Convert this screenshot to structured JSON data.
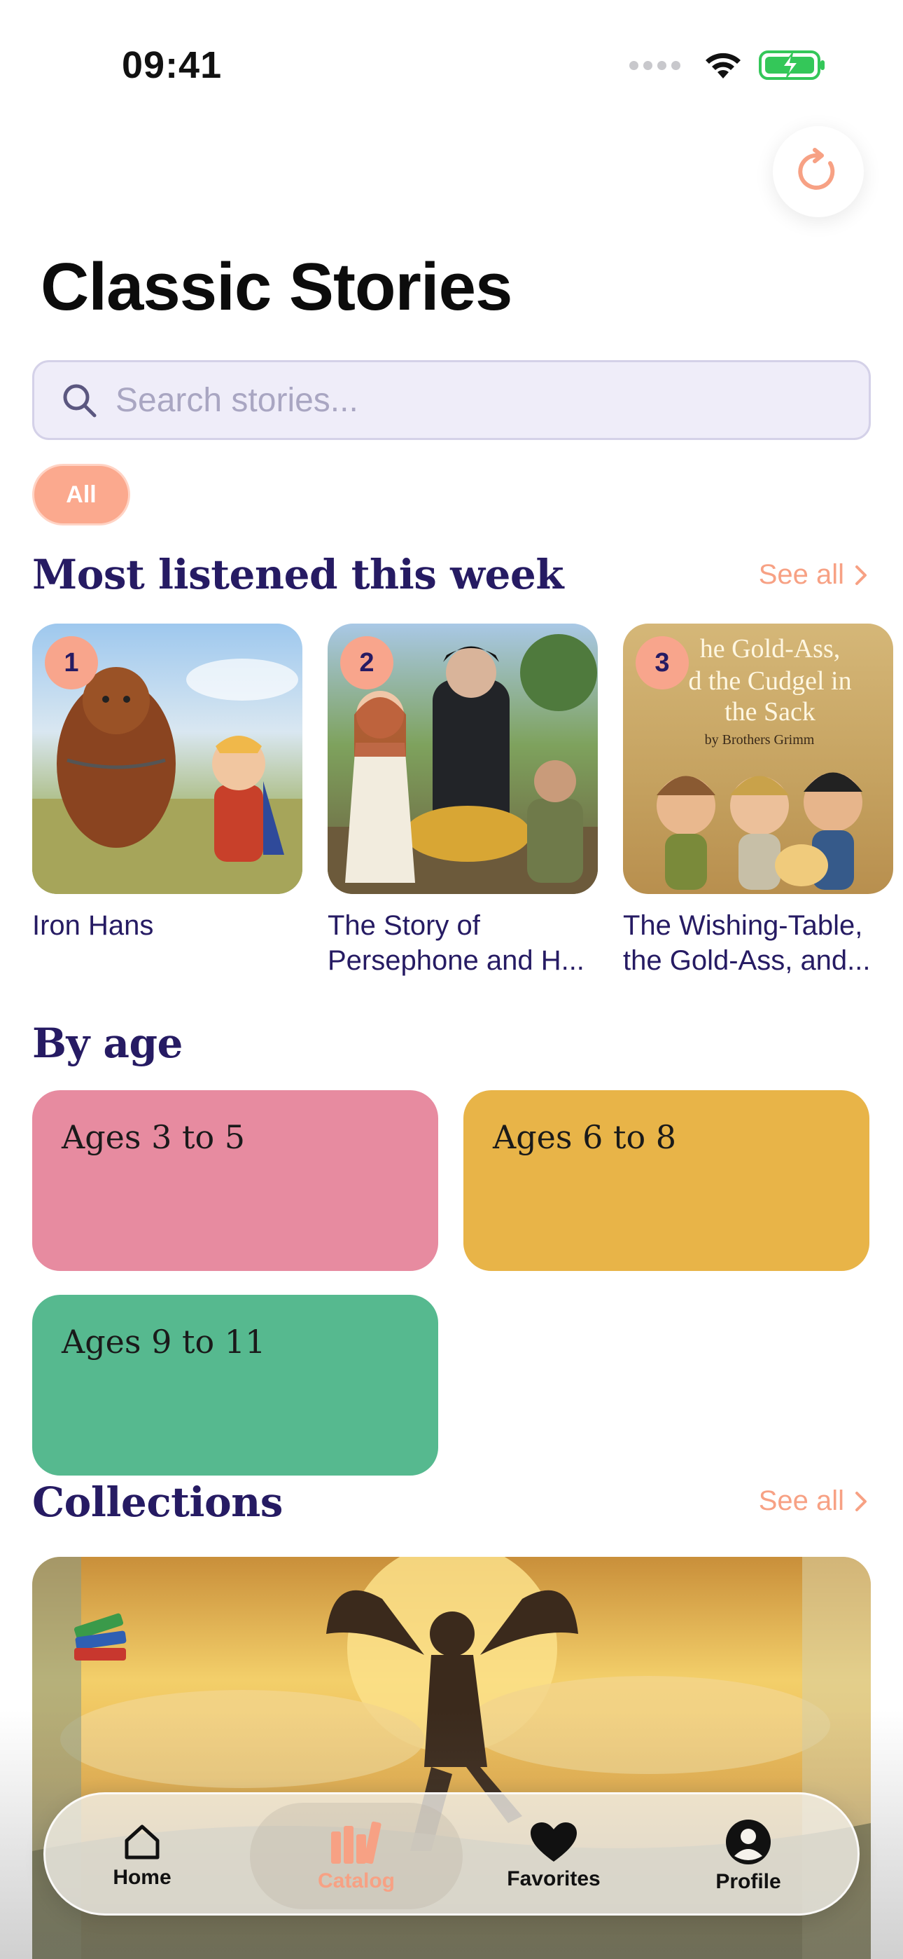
{
  "status_bar": {
    "time": "09:41"
  },
  "header": {
    "title": "Classic Stories"
  },
  "search": {
    "placeholder": "Search stories..."
  },
  "filters": {
    "chips": [
      "All"
    ]
  },
  "most_listened": {
    "title": "Most listened this week",
    "see_all": "See all",
    "items": [
      {
        "rank": "1",
        "title": "Iron Hans"
      },
      {
        "rank": "2",
        "title": "The Story of Persephone and H..."
      },
      {
        "rank": "3",
        "title": "The Wishing-Table, the Gold-Ass, and..."
      }
    ],
    "cover3_text": {
      "line1": "he Gold-Ass,",
      "line2": "d the Cudgel in",
      "line3": "the Sack",
      "line4": "by Brothers Grimm"
    }
  },
  "by_age": {
    "title": "By age",
    "groups": [
      {
        "label": "Ages 3 to 5",
        "color": "#e78ba0"
      },
      {
        "label": "Ages 6 to 8",
        "color": "#e8b448"
      },
      {
        "label": "Ages 9 to 11",
        "color": "#56b98f"
      }
    ]
  },
  "collections": {
    "title": "Collections",
    "see_all": "See all"
  },
  "tabbar": {
    "tabs": [
      {
        "label": "Home",
        "icon": "home-icon"
      },
      {
        "label": "Catalog",
        "icon": "books-icon"
      },
      {
        "label": "Favorites",
        "icon": "heart-icon"
      },
      {
        "label": "Profile",
        "icon": "person-circle-icon"
      }
    ],
    "active": "Catalog"
  },
  "colors": {
    "accent": "#f7a184",
    "title_ink": "#261b63"
  }
}
